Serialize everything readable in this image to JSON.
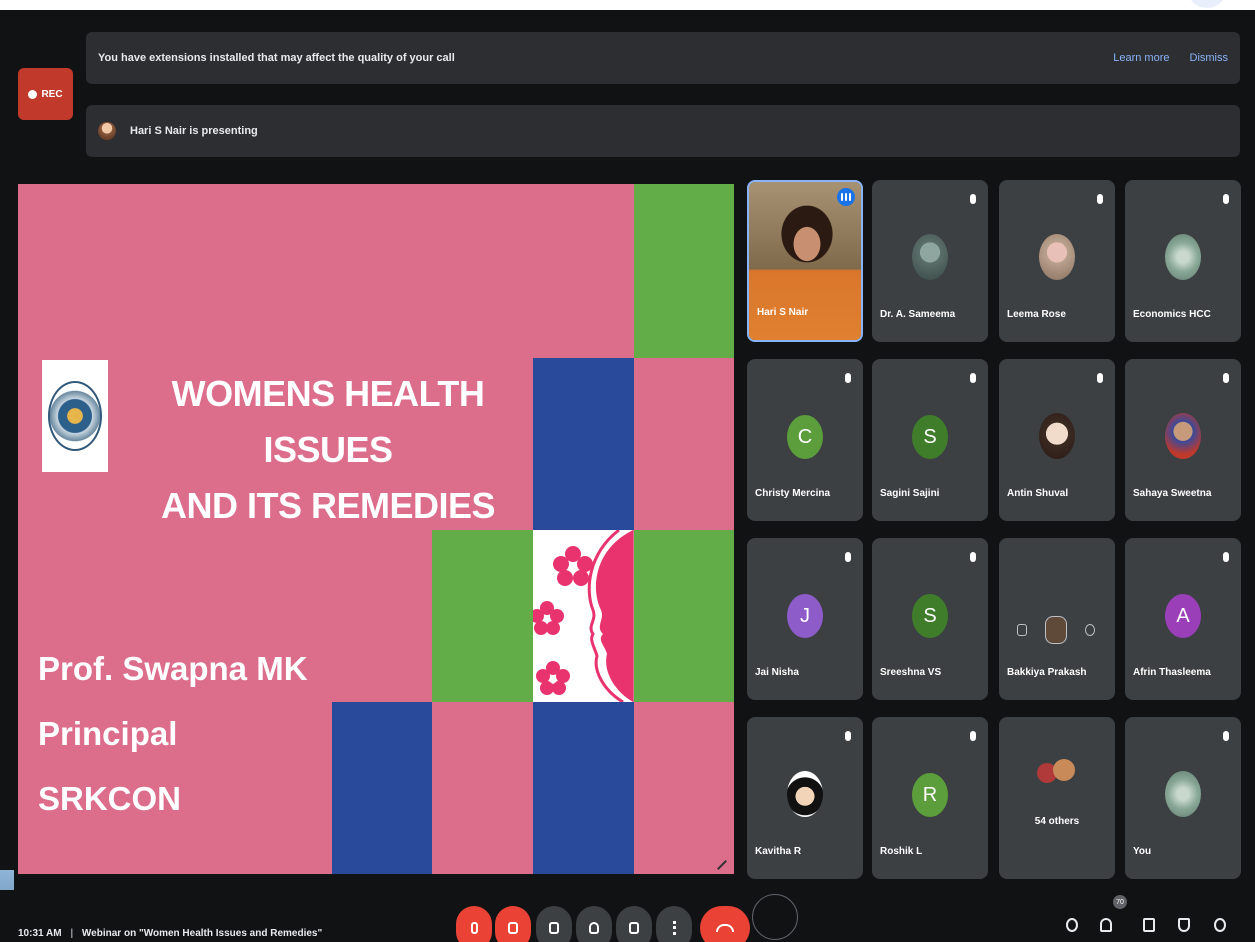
{
  "notification": {
    "rec_label": "REC",
    "extensions_message": "You have extensions installed that may affect the quality of your call",
    "learn_more": "Learn more",
    "dismiss": "Dismiss",
    "presenting_message": "Hari S Nair is presenting"
  },
  "slide": {
    "title_line1": "WOMENS HEALTH ISSUES",
    "title_line2": "AND ITS REMEDIES",
    "author_name": "Prof. Swapna MK",
    "author_role": "Principal",
    "author_org": "SRKCON",
    "colors": {
      "pink": "#dc6d8b",
      "green": "#62ad47",
      "blue": "#294a9a",
      "art_pink": "#e8336e"
    }
  },
  "participants": [
    {
      "name": "Hari S Nair",
      "kind": "video",
      "speaking": true
    },
    {
      "name": "Dr. A. Sameema",
      "kind": "photo",
      "color": "#5a6e6a"
    },
    {
      "name": "Leema Rose",
      "kind": "photo",
      "color": "#c7b09c"
    },
    {
      "name": "Economics HCC",
      "kind": "photo",
      "color": "#a8c0b2"
    },
    {
      "name": "Christy Mercina",
      "kind": "letter",
      "letter": "C",
      "color": "#5d9e3c"
    },
    {
      "name": "Sagini Sajini",
      "kind": "letter",
      "letter": "S",
      "color": "#3f7d2a"
    },
    {
      "name": "Antin Shuval",
      "kind": "photo",
      "color": "#e6cdb5"
    },
    {
      "name": "Sahaya Sweetna",
      "kind": "photo",
      "color": "#6a5a9a"
    },
    {
      "name": "Jai Nisha",
      "kind": "letter",
      "letter": "J",
      "color": "#8e5cc9"
    },
    {
      "name": "Sreeshna VS",
      "kind": "letter",
      "letter": "S",
      "color": "#3f7d2a"
    },
    {
      "name": "Bakkiya Prakash",
      "kind": "hover"
    },
    {
      "name": "Afrin Thasleema",
      "kind": "letter",
      "letter": "A",
      "color": "#9a3fb8"
    },
    {
      "name": "Kavitha R",
      "kind": "photo",
      "color": "#f4f4f4"
    },
    {
      "name": "Roshik L",
      "kind": "letter",
      "letter": "R",
      "color": "#5d9e3c"
    },
    {
      "name": "54 others",
      "kind": "others"
    },
    {
      "name": "You",
      "kind": "photo",
      "color": "#a8c0b2"
    }
  ],
  "bottombar": {
    "time": "10:31 AM",
    "separator": "|",
    "meeting_title": "Webinar on \"Women Health Issues and Remedies\"",
    "people_count": "70"
  }
}
